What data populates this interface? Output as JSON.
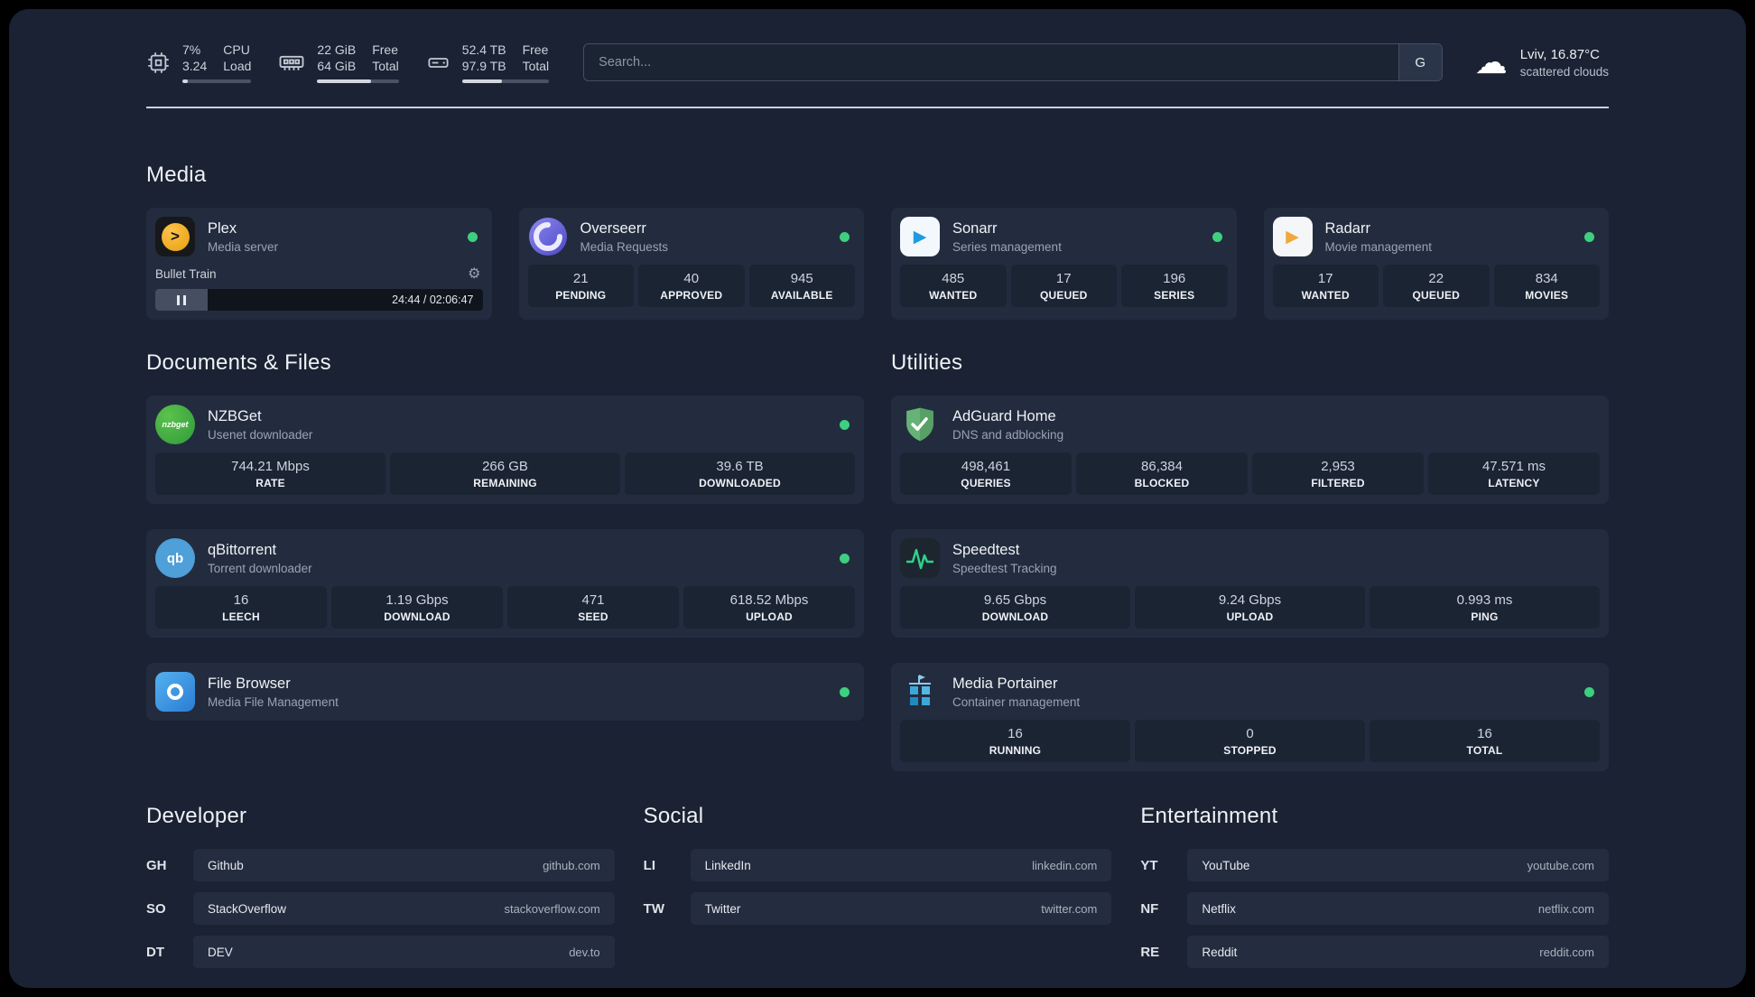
{
  "topbar": {
    "cpu": {
      "icon": "cpu-chip-icon",
      "percent": "7%",
      "load": "3.24",
      "label1": "CPU",
      "label2": "Load",
      "progress_pct": 8
    },
    "memory": {
      "icon": "memory-icon",
      "free": "22 GiB",
      "total": "64 GiB",
      "label1": "Free",
      "label2": "Total",
      "progress_pct": 66
    },
    "storage": {
      "icon": "disk-icon",
      "free": "52.4 TB",
      "total": "97.9 TB",
      "label1": "Free",
      "label2": "Total",
      "progress_pct": 46
    },
    "search": {
      "placeholder": "Search...",
      "provider_label": "G"
    },
    "weather": {
      "icon": "cloud-icon",
      "location": "Lviv, 16.87°C",
      "condition": "scattered clouds"
    }
  },
  "media": {
    "title": "Media",
    "cards": [
      {
        "icon": "plex-icon",
        "name": "Plex",
        "subtitle": "Media server",
        "status": "online",
        "now_playing": {
          "title": "Bullet Train",
          "state": "paused",
          "elapsed_total": "24:44 / 02:06:47"
        }
      },
      {
        "icon": "overseerr-icon",
        "name": "Overseerr",
        "subtitle": "Media Requests",
        "status": "online",
        "stats": [
          {
            "value": "21",
            "label": "PENDING"
          },
          {
            "value": "40",
            "label": "APPROVED"
          },
          {
            "value": "945",
            "label": "AVAILABLE"
          }
        ]
      },
      {
        "icon": "sonarr-icon",
        "name": "Sonarr",
        "subtitle": "Series management",
        "status": "online",
        "stats": [
          {
            "value": "485",
            "label": "WANTED"
          },
          {
            "value": "17",
            "label": "QUEUED"
          },
          {
            "value": "196",
            "label": "SERIES"
          }
        ]
      },
      {
        "icon": "radarr-icon",
        "name": "Radarr",
        "subtitle": "Movie management",
        "status": "online",
        "stats": [
          {
            "value": "17",
            "label": "WANTED"
          },
          {
            "value": "22",
            "label": "QUEUED"
          },
          {
            "value": "834",
            "label": "MOVIES"
          }
        ]
      }
    ]
  },
  "documents": {
    "title": "Documents & Files",
    "cards": [
      {
        "icon": "nzbget-icon",
        "name": "NZBGet",
        "subtitle": "Usenet downloader",
        "status": "online",
        "stats": [
          {
            "value": "744.21 Mbps",
            "label": "RATE"
          },
          {
            "value": "266 GB",
            "label": "REMAINING"
          },
          {
            "value": "39.6 TB",
            "label": "DOWNLOADED"
          }
        ]
      },
      {
        "icon": "qbittorrent-icon",
        "name": "qBittorrent",
        "subtitle": "Torrent downloader",
        "status": "online",
        "stats": [
          {
            "value": "16",
            "label": "LEECH"
          },
          {
            "value": "1.19 Gbps",
            "label": "DOWNLOAD"
          },
          {
            "value": "471",
            "label": "SEED"
          },
          {
            "value": "618.52 Mbps",
            "label": "UPLOAD"
          }
        ]
      },
      {
        "icon": "filebrowser-icon",
        "name": "File Browser",
        "subtitle": "Media File Management",
        "status": "online"
      }
    ]
  },
  "utilities": {
    "title": "Utilities",
    "cards": [
      {
        "icon": "adguard-icon",
        "name": "AdGuard Home",
        "subtitle": "DNS and adblocking",
        "stats": [
          {
            "value": "498,461",
            "label": "QUERIES"
          },
          {
            "value": "86,384",
            "label": "BLOCKED"
          },
          {
            "value": "2,953",
            "label": "FILTERED"
          },
          {
            "value": "47.571 ms",
            "label": "LATENCY"
          }
        ]
      },
      {
        "icon": "speedtest-icon",
        "name": "Speedtest",
        "subtitle": "Speedtest Tracking",
        "stats": [
          {
            "value": "9.65 Gbps",
            "label": "DOWNLOAD"
          },
          {
            "value": "9.24 Gbps",
            "label": "UPLOAD"
          },
          {
            "value": "0.993 ms",
            "label": "PING"
          }
        ]
      },
      {
        "icon": "portainer-icon",
        "name": "Media Portainer",
        "subtitle": "Container management",
        "status": "online",
        "stats": [
          {
            "value": "16",
            "label": "RUNNING"
          },
          {
            "value": "0",
            "label": "STOPPED"
          },
          {
            "value": "16",
            "label": "TOTAL"
          }
        ]
      }
    ]
  },
  "bookmarks": {
    "groups": [
      {
        "title": "Developer",
        "links": [
          {
            "abbr": "GH",
            "name": "Github",
            "url": "github.com"
          },
          {
            "abbr": "SO",
            "name": "StackOverflow",
            "url": "stackoverflow.com"
          },
          {
            "abbr": "DT",
            "name": "DEV",
            "url": "dev.to"
          }
        ]
      },
      {
        "title": "Social",
        "links": [
          {
            "abbr": "LI",
            "name": "LinkedIn",
            "url": "linkedin.com"
          },
          {
            "abbr": "TW",
            "name": "Twitter",
            "url": "twitter.com"
          }
        ]
      },
      {
        "title": "Entertainment",
        "links": [
          {
            "abbr": "YT",
            "name": "YouTube",
            "url": "youtube.com"
          },
          {
            "abbr": "NF",
            "name": "Netflix",
            "url": "netflix.com"
          },
          {
            "abbr": "RE",
            "name": "Reddit",
            "url": "reddit.com"
          }
        ]
      }
    ]
  },
  "colors": {
    "background": "#1a2233",
    "card": "#232c3e",
    "stat_tile": "#1b2433",
    "status_online": "#3ecf7f",
    "plex_amber": "#e5a00d",
    "adguard_green": "#67b279",
    "portainer_blue": "#39a9db",
    "speedtest_green": "#2fd18c"
  }
}
